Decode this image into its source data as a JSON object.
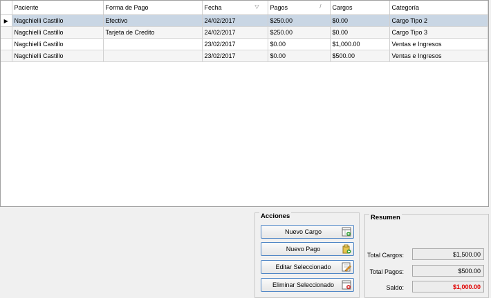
{
  "grid": {
    "columns": [
      "Paciente",
      "Forma de Pago",
      "Fecha",
      "Pagos",
      "Cargos",
      "Categoría"
    ],
    "rows": [
      {
        "paciente": "Nagchielli Castillo",
        "forma": "Efectivo",
        "fecha": "24/02/2017",
        "pagos": "$250.00",
        "cargos": "$0.00",
        "categoria": "Cargo Tipo 2"
      },
      {
        "paciente": "Nagchielli Castillo",
        "forma": "Tarjeta de Credito",
        "fecha": "24/02/2017",
        "pagos": "$250.00",
        "cargos": "$0.00",
        "categoria": "Cargo Tipo 3"
      },
      {
        "paciente": "Nagchielli Castillo",
        "forma": "",
        "fecha": "23/02/2017",
        "pagos": "$0.00",
        "cargos": "$1,000.00",
        "categoria": "Ventas e Ingresos"
      },
      {
        "paciente": "Nagchielli Castillo",
        "forma": "",
        "fecha": "23/02/2017",
        "pagos": "$0.00",
        "cargos": "$500.00",
        "categoria": "Ventas e Ingresos"
      }
    ],
    "selected_row": 0,
    "sort": {
      "fecha": "filter-icon",
      "pagos": "sort-icon"
    }
  },
  "acciones": {
    "title": "Acciones",
    "nuevo_cargo": "Nuevo Cargo",
    "nuevo_pago": "Nuevo Pago",
    "editar": "Editar Seleccionado",
    "eliminar": "Eliminar Seleccionado"
  },
  "resumen": {
    "title": "Resumen",
    "total_cargos_label": "Total Cargos:",
    "total_cargos": "$1,500.00",
    "total_pagos_label": "Total Pagos:",
    "total_pagos": "$500.00",
    "saldo_label": "Saldo:",
    "saldo": "$1,000.00"
  },
  "colors": {
    "selected_row": "#c9d6e4",
    "saldo": "#e00000",
    "button_border": "#4f86c6"
  }
}
